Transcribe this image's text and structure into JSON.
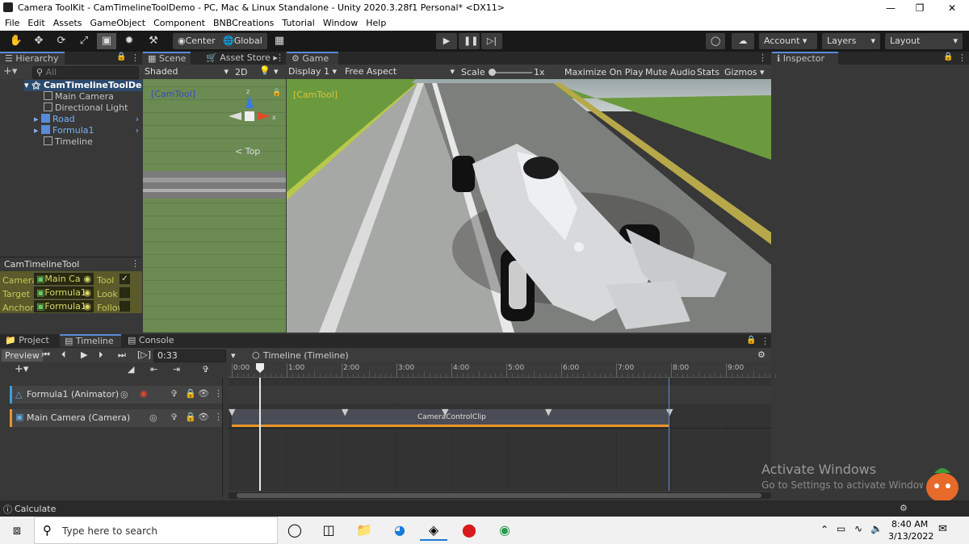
{
  "window": {
    "title": "Camera ToolKit - CamTimelineToolDemo - PC, Mac & Linux Standalone - Unity 2020.3.28f1 Personal* <DX11>"
  },
  "menu": [
    "File",
    "Edit",
    "Assets",
    "GameObject",
    "Component",
    "BNBCreations",
    "Tutorial",
    "Window",
    "Help"
  ],
  "toolbar": {
    "pivot": "Center",
    "space": "Global",
    "account": "Account",
    "layers": "Layers",
    "layout": "Layout"
  },
  "hierarchy": {
    "tab": "Hierarchy",
    "search_placeholder": "All",
    "root": "CamTimelineToolDe",
    "items": [
      "Main Camera",
      "Directional Light",
      "Road",
      "Formula1",
      "Timeline"
    ]
  },
  "camtool": {
    "title": "CamTimelineTool",
    "rows": [
      {
        "label": "Camera",
        "value": "Main Ca",
        "flag": "Tool"
      },
      {
        "label": "Target",
        "value": "Formula1",
        "flag": "Look"
      },
      {
        "label": "Anchor",
        "value": "Formula1",
        "flag": "Follow"
      }
    ]
  },
  "scene": {
    "tab": "Scene",
    "tab2": "Asset Store",
    "shading": "Shaded",
    "mode2d": "2D",
    "overlay": "[CamTool]",
    "gizmo_label": "< Top",
    "axis_x": "x",
    "axis_z": "z"
  },
  "game": {
    "tab": "Game",
    "display": "Display 1",
    "aspect": "Free Aspect",
    "scale_label": "Scale",
    "scale_value": "1x",
    "maximize": "Maximize On Play",
    "mute": "Mute Audio",
    "stats": "Stats",
    "gizmos": "Gizmos",
    "overlay": "[CamTool]"
  },
  "inspector": {
    "tab": "Inspector"
  },
  "bottom": {
    "tabs": [
      "Project",
      "Timeline",
      "Console"
    ],
    "preview": "Preview",
    "time": "0:33",
    "asset": "Timeline (Timeline)",
    "ruler": [
      "0:00",
      "1:00",
      "2:00",
      "3:00",
      "4:00",
      "5:00",
      "6:00",
      "7:00",
      "8:00",
      "9:00"
    ],
    "tracks": [
      {
        "name": "Formula1 (Animator)"
      },
      {
        "name": "Main Camera (Camera)",
        "clip": "CameraControlClip"
      }
    ]
  },
  "watermark": {
    "line1": "Activate Windows",
    "line2": "Go to Settings to activate Windows."
  },
  "status": {
    "text": "Calculate"
  },
  "taskbar": {
    "search": "Type here to search",
    "time": "8:40 AM",
    "date": "3/13/2022"
  },
  "colors": {
    "accent": "#5a8bd8",
    "camtool_yellow": "#c8c85a",
    "clip_orange": "#e8952a"
  }
}
